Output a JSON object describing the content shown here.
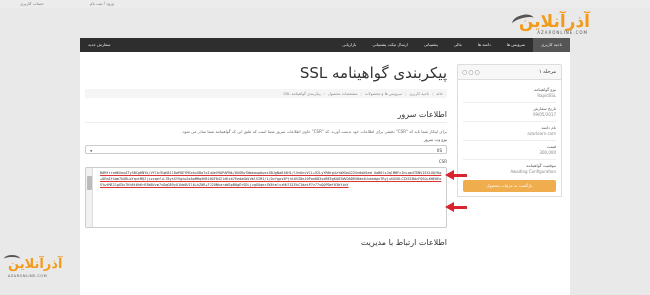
{
  "topbar": {
    "left_text": "حساب کاربری",
    "right_text": "ورود / ثبت نام"
  },
  "logo": {
    "main": "آذرآنلاین",
    "sub": "AZARONLINE.COM"
  },
  "nav": {
    "items": [
      {
        "label": "ناحیه کاربری"
      },
      {
        "label": "سرویس ها"
      },
      {
        "label": "دامنه ها"
      },
      {
        "label": "مالی"
      },
      {
        "label": "پشتیبانی"
      },
      {
        "label": "ارسال تیکت پشتیبانی"
      },
      {
        "label": "بازاریابی"
      },
      {
        "label": "سفارش جدید"
      }
    ]
  },
  "sidebar": {
    "title": "مرحله ۱",
    "dots": "○○○",
    "fields": [
      {
        "key": "نوع گواهینامه",
        "value": "RapidSSL"
      },
      {
        "key": "تاریخ سفارش",
        "value": "09/05/2017"
      },
      {
        "key": "نام دامنه",
        "value": "azarlearn.com"
      },
      {
        "key": "قیمت",
        "value": "300,000"
      },
      {
        "key": "موقعیت گواهینامه",
        "value": "Awaiting Configuration"
      }
    ],
    "back_button": "بازگشت به جزئیات محصول"
  },
  "main": {
    "title": "پیکربندی گواهینامه SSL",
    "breadcrumb": [
      "خانه",
      "ناحیه کاربری",
      "سرویس ها و محصولات",
      "مشخصات محصول",
      "پیکربندی گواهینامه SSL"
    ],
    "server_section": "اطلاعات سرور",
    "server_paragraph": "برای اینکار شما باید کد \"CSR\" دقیقی برای اطلاعات خود بدست آورید. کد \"CSR\" حاوی اطلاعات سرور شما است که طبق این کد گواهینامه شما صادر می شود.",
    "server_type_label": "نوع وب سرور",
    "server_type_value": "IIS",
    "csr_label": "CSR",
    "csr_text": "B0MfrraH6XeuATySBCgRNYk/VYlkfEqK81lDaPDEYMSxkxXBa7oIuUeV9OPAPNk/0UGRw7NmeaupbwxsSBJgNa818H1/lVnUnvVCL+92LyYRNrg4ztWXGmG22Vn0oN1md UaB0lsJqlMBFc1hLqe4TENVJEXLUQfKq+OEmZf4qm7kGBLbYqvtMQ2)szzqef+L78ysSYSgtw2eAoMHq5H810GF842ldEzb7EedaGWiVmlSIM1/1/Ozfgps5PjhtUVZ0eJ0Poe883sdBEEgKQ82WVQ0DR5Dde4Uuhedgx7RyjuXGVULCZXSIBdcFQSQ+6HE0EoSYwtME21gG5v7Kh6t6h6rR3W0Vzm7vDqG89yU1hb0UIl6+hZ0R+FJ2ONharaW3pB0gEtSDLjzgGUqmrZK6tmlvzHU7SIEkCIdatP7v77vQQPDef03bYimY",
    "contact_section": "اطلاعات ارتباط با مدیریت"
  },
  "watermark": {
    "main": "آذرآنلاین",
    "sub": "AZARONLINE.COM"
  },
  "colors": {
    "accent": "#f39a1b",
    "nav_bg": "#2e2e2e",
    "arrow": "#d9232d",
    "button": "#f0ad4e"
  }
}
